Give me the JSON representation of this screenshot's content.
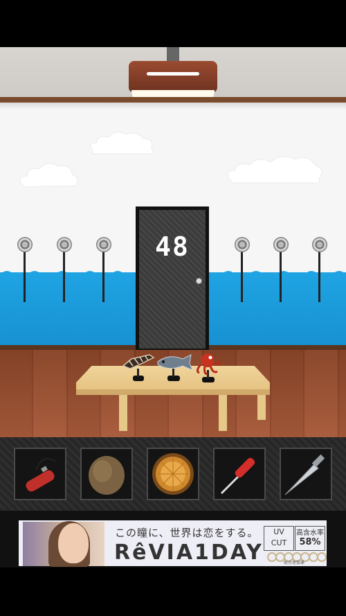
{
  "room": {
    "door_number": "48",
    "table_items": [
      "crab-figure",
      "fish-figure",
      "octopus-figure"
    ],
    "hooks_left_count": 3,
    "hooks_right_count": 3
  },
  "inventory": {
    "slots": [
      {
        "item": "fire-extinguisher-icon",
        "color": "#c0302a"
      },
      {
        "item": "round-bread-icon",
        "color": "#7a6242"
      },
      {
        "item": "wooden-bucket-icon",
        "color": "#d08a2e"
      },
      {
        "item": "screwdriver-icon",
        "color": "#d32e2a"
      },
      {
        "item": "kitchen-knife-icon",
        "color": "#cfd4d8"
      }
    ]
  },
  "ad": {
    "tagline": "この瞳に、世界は恋をする。",
    "brand": "RêVIA1DAY",
    "uv_line1": "UV",
    "uv_line2": "CUT",
    "rate_label": "高含水率",
    "rate_value": "58%",
    "maker": "販売者製薬"
  },
  "colors": {
    "wall_blue": "#1fa4e3",
    "door": "#3a3a3a",
    "floor": "#9a4d2d"
  }
}
